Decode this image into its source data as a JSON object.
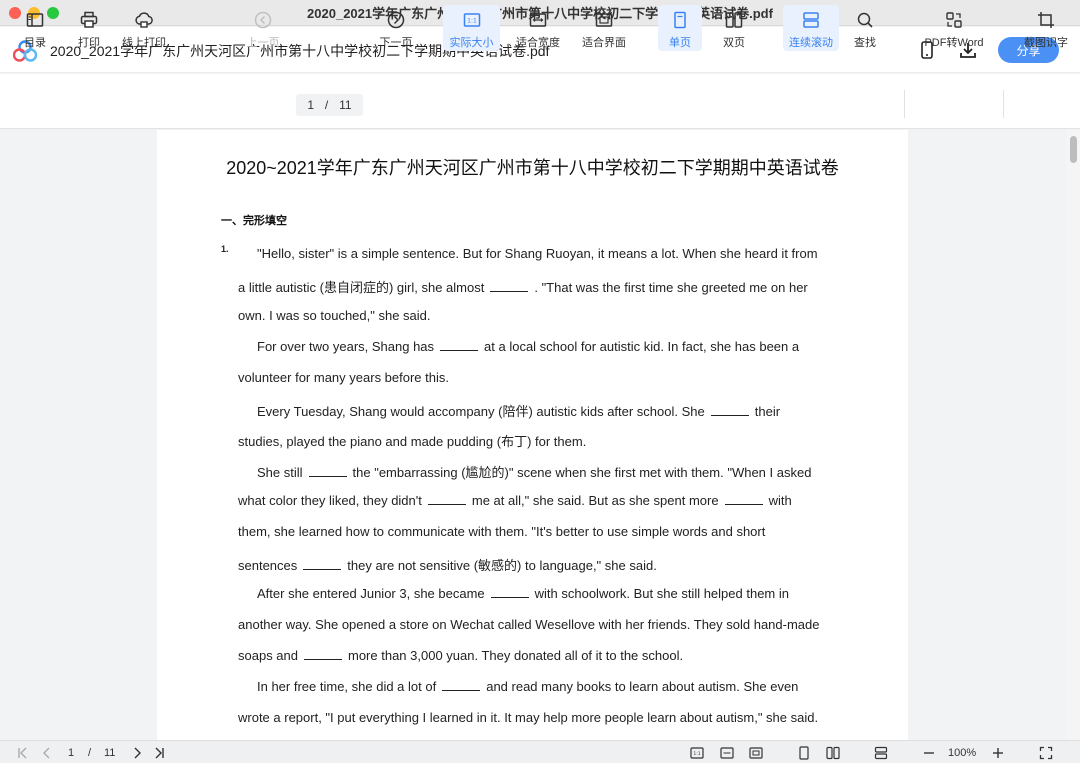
{
  "window": {
    "title": "2020_2021学年广东广州天河区广州市第十八中学校初二下学期期中英语试卷.pdf"
  },
  "header": {
    "doc_title": "2020_2021学年广东广州天河区广州市第十八中学校初二下学期期中英语试卷.pdf",
    "share_label": "分享",
    "icons": [
      "phone-icon",
      "download-icon"
    ]
  },
  "toolbar": {
    "toc": "目录",
    "print": "打印",
    "online_print": "线上打印",
    "prev_page": "上一页",
    "current_page": "1",
    "page_sep": "/",
    "total_pages": "11",
    "next_page": "下一页",
    "actual_size": "实际大小",
    "fit_width": "适合宽度",
    "fit_page": "适合界面",
    "single_page": "单页",
    "double_page": "双页",
    "continuous": "连续滚动",
    "search": "查找",
    "pdf_to_word": "PDF转Word",
    "ocr": "截图识字",
    "actual_size_badge": "1:1"
  },
  "document": {
    "title": "2020~2021学年广东广州天河区广州市第十八中学校初二下学期期中英语试卷",
    "section": "一、完形填空",
    "qnum": "1.",
    "lines": [
      {
        "parts": [
          "\"Hello, sister\" is a simple sentence. But for Shang Ruoyan, it means a lot. When she heard it from"
        ]
      },
      {
        "parts": [
          "a little autistic (患自闭症的) girl, she almost",
          ". \"That was the first time she greeted me on her"
        ]
      },
      {
        "parts": [
          "own. I was so touched,\" she said."
        ]
      },
      {
        "parts": [
          "For over two years, Shang has",
          "at a local school for autistic kid. In fact, she has been a"
        ]
      },
      {
        "parts": [
          "volunteer for many years before this."
        ]
      },
      {
        "parts": [
          "Every Tuesday, Shang would accompany (陪伴) autistic kids after school. She",
          "their"
        ]
      },
      {
        "parts": [
          "studies, played the piano and made pudding (布丁) for them."
        ]
      },
      {
        "parts": [
          "She still",
          "the \"embarrassing (尴尬的)\" scene when she first met with them. \"When I asked"
        ]
      },
      {
        "parts": [
          "what color they liked, they didn't",
          "me at all,\" she said. But as she spent more",
          "with"
        ]
      },
      {
        "parts": [
          "them, she learned how to communicate with them. \"It's better to use simple words and short"
        ]
      },
      {
        "parts": [
          "sentences",
          "they are not sensitive (敏感的) to language,\" she said."
        ]
      },
      {
        "parts": [
          "After she entered Junior 3, she became",
          "with schoolwork. But she still helped them in"
        ]
      },
      {
        "parts": [
          "another way. She opened a store on Wechat called Wesellove with her friends. They sold hand-made"
        ]
      },
      {
        "parts": [
          "soaps and",
          "more than 3,000 yuan. They donated all of it to the school."
        ]
      },
      {
        "parts": [
          "In her free time, she did a lot of",
          "and read many books to learn about autism. She even"
        ]
      },
      {
        "parts": [
          "wrote a report, \"I put everything I learned in it. It may help more people learn about autism,\" she said."
        ]
      }
    ]
  },
  "statusbar": {
    "current_page": "1",
    "page_sep": "/",
    "total_pages": "11",
    "zoom": "100%",
    "actual_size_badge": "1:1"
  },
  "colors": {
    "accent": "#4a90f5",
    "active_bg": "#e8f1fd",
    "active_text": "#3a82f0"
  }
}
